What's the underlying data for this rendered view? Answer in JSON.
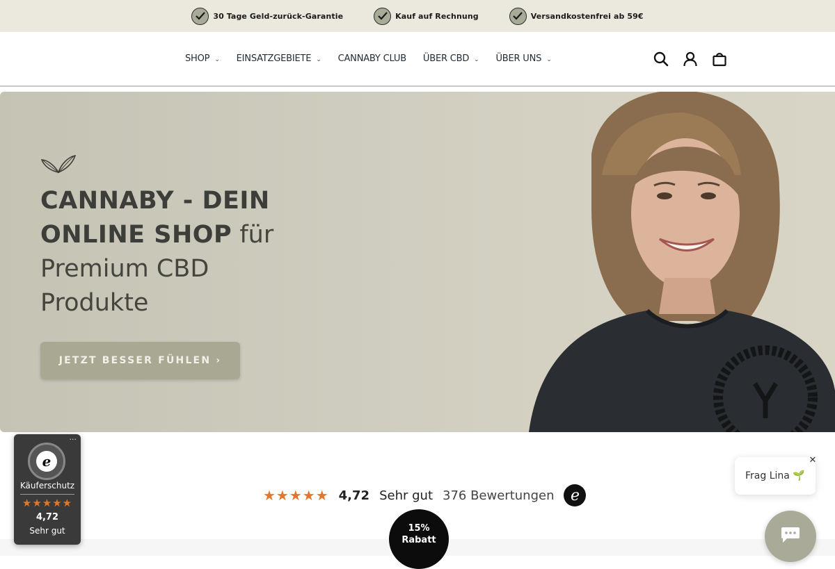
{
  "topbar": {
    "usps": [
      {
        "label": "30 Tage Geld-zurück-Garantie",
        "icon": "check-circle-icon"
      },
      {
        "label": "Kauf auf Rechnung",
        "icon": "check-circle-icon"
      },
      {
        "label": "Versandkostenfrei ab 59€",
        "icon": "check-circle-icon"
      }
    ],
    "background": "#ebe9dd"
  },
  "nav": {
    "items": [
      {
        "label": "SHOP",
        "has_dropdown": true
      },
      {
        "label": "EINSATZGEBIETE",
        "has_dropdown": true
      },
      {
        "label": "CANNABY CLUB",
        "has_dropdown": false
      },
      {
        "label": "ÜBER CBD",
        "has_dropdown": true
      },
      {
        "label": "ÜBER UNS",
        "has_dropdown": true
      }
    ],
    "icons": [
      "search-icon",
      "account-icon",
      "cart-icon"
    ]
  },
  "hero": {
    "title_bold_1": "CANNABY - DEIN",
    "title_bold_2": "ONLINE SHOP",
    "title_light_1": "für",
    "title_light_2": "Premium CBD",
    "title_light_3": "Produkte",
    "button_label": "JETZT BESSER FÜHLEN ›",
    "background": "#cfcdbf",
    "button_color": "#a9a893"
  },
  "rating": {
    "stars": "★★★★★",
    "score": "4,72",
    "verdict": "Sehr gut",
    "count": "376 Bewertungen",
    "logo_letter": "e"
  },
  "discount": {
    "percent": "15%",
    "label": "Rabatt"
  },
  "trusted_badge": {
    "menu": "···",
    "seal_letter": "e",
    "label": "Käuferschutz",
    "stars": "★★★★★",
    "score": "4,72",
    "verdict": "Sehr gut"
  },
  "chat": {
    "bubble_label": "Frag Lina 🌱",
    "close": "✕",
    "button_icon": "chat-icon",
    "button_color": "#a9aa98"
  }
}
